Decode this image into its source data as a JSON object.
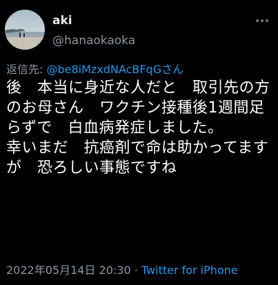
{
  "user": {
    "display_name": "aki",
    "username": "@hanaokaoka",
    "avatar_icon": "beach-photo-avatar"
  },
  "reply": {
    "label": "返信先: ",
    "to": "@be8iMzxdNAcBFqGさん"
  },
  "tweet": {
    "text": "後　本当に身近な人だと　取引先の方のお母さん　ワクチン接種後1週間足らずで　白血病発症しました。\n幸いまだ　抗癌剤で命は助かってますが　恐ろしい事態ですね"
  },
  "meta": {
    "timestamp": "2022年05月14日 20:30",
    "separator": " · ",
    "source": "Twitter for iPhone"
  },
  "colors": {
    "background": "#000000",
    "text": "#ffffff",
    "secondary": "#8b98a5",
    "link": "#1d9bf0"
  }
}
